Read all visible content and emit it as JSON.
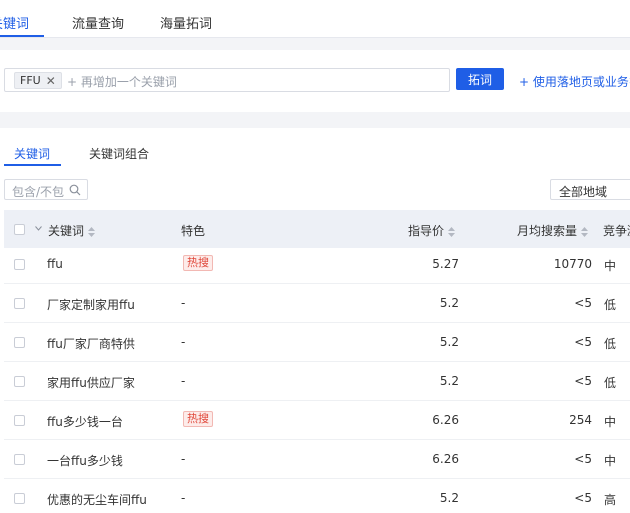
{
  "top_tabs": [
    {
      "label": "关键词",
      "active": true
    },
    {
      "label": "流量查询",
      "active": false
    },
    {
      "label": "海量拓词",
      "active": false
    }
  ],
  "search": {
    "chip_label": "FFU",
    "add_placeholder": "+ 再增加一个关键词",
    "submit_label": "拓词",
    "side_link": "+ 使用落地页或业务扌"
  },
  "sub_tabs": [
    {
      "label": "关键词",
      "active": true
    },
    {
      "label": "关键词组合",
      "active": false
    }
  ],
  "filter": {
    "placeholder": "包含/不包含",
    "region": "全部地域"
  },
  "table": {
    "headers": {
      "keyword": "关键词",
      "feature": "特色",
      "price": "指导价",
      "volume": "月均搜索量",
      "competition": "竞争激烈"
    },
    "rows": [
      {
        "keyword": "ffu",
        "feature": "热搜",
        "hot": true,
        "price": "5.27",
        "volume": "10770",
        "competition": "中"
      },
      {
        "keyword": "厂家定制家用ffu",
        "feature": "-",
        "hot": false,
        "price": "5.2",
        "volume": "<5",
        "competition": "低"
      },
      {
        "keyword": "ffu厂家厂商特供",
        "feature": "-",
        "hot": false,
        "price": "5.2",
        "volume": "<5",
        "competition": "低"
      },
      {
        "keyword": "家用ffu供应厂家",
        "feature": "-",
        "hot": false,
        "price": "5.2",
        "volume": "<5",
        "competition": "低"
      },
      {
        "keyword": "ffu多少钱一台",
        "feature": "热搜",
        "hot": true,
        "price": "6.26",
        "volume": "254",
        "competition": "中"
      },
      {
        "keyword": "一台ffu多少钱",
        "feature": "-",
        "hot": false,
        "price": "6.26",
        "volume": "<5",
        "competition": "中"
      },
      {
        "keyword": "优惠的无尘车间ffu",
        "feature": "-",
        "hot": false,
        "price": "5.2",
        "volume": "<5",
        "competition": "高"
      }
    ]
  },
  "colors": {
    "accent": "#1f5ee6",
    "hot_badge_text": "#e0483b",
    "hot_badge_bg": "#fdecea"
  }
}
